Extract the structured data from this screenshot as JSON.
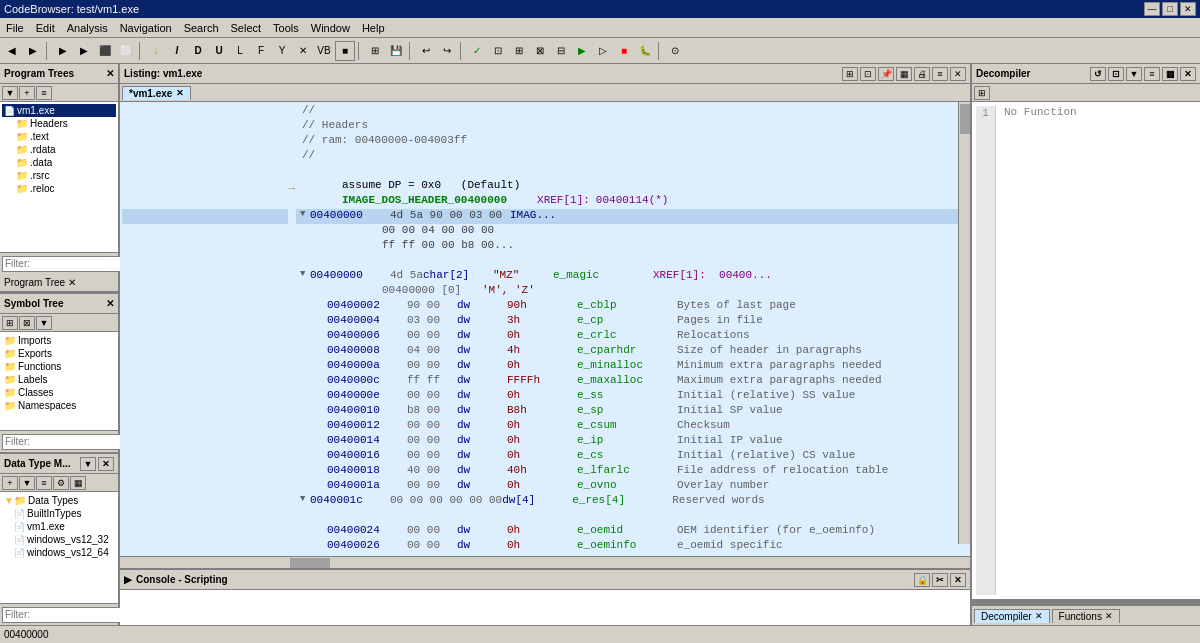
{
  "title_bar": {
    "title": "CodeBrowser: test/vm1.exe",
    "controls": [
      "—",
      "□",
      "✕"
    ]
  },
  "menu": {
    "items": [
      "File",
      "Edit",
      "Analysis",
      "Navigation",
      "Search",
      "Select",
      "Tools",
      "Window",
      "Help"
    ]
  },
  "panels": {
    "program_trees": {
      "label": "Program Trees",
      "tree_items": [
        {
          "label": "vm1.exe",
          "indent": 0,
          "type": "file",
          "expanded": true
        },
        {
          "label": "Headers",
          "indent": 1,
          "type": "folder"
        },
        {
          "label": ".text",
          "indent": 1,
          "type": "folder"
        },
        {
          "label": ".rdata",
          "indent": 1,
          "type": "folder"
        },
        {
          "label": ".data",
          "indent": 1,
          "type": "folder"
        },
        {
          "label": ".rsrc",
          "indent": 1,
          "type": "folder"
        },
        {
          "label": ".reloc",
          "indent": 1,
          "type": "folder"
        }
      ],
      "filter_placeholder": "Filter:"
    },
    "symbol_tree": {
      "label": "Symbol Tree",
      "tree_items": [
        {
          "label": "Imports",
          "indent": 0,
          "type": "folder"
        },
        {
          "label": "Exports",
          "indent": 0,
          "type": "folder"
        },
        {
          "label": "Functions",
          "indent": 0,
          "type": "folder"
        },
        {
          "label": "Labels",
          "indent": 0,
          "type": "folder"
        },
        {
          "label": "Classes",
          "indent": 0,
          "type": "folder"
        },
        {
          "label": "Namespaces",
          "indent": 0,
          "type": "folder"
        }
      ],
      "filter_placeholder": "Filter:"
    },
    "data_type_manager": {
      "label": "Data Type M...",
      "tree_items": [
        {
          "label": "Data Types",
          "indent": 0,
          "type": "folder",
          "expanded": true
        },
        {
          "label": "BuiltInTypes",
          "indent": 1,
          "type": "folder"
        },
        {
          "label": "vm1.exe",
          "indent": 1,
          "type": "file"
        },
        {
          "label": "windows_vs12_32",
          "indent": 1,
          "type": "file"
        },
        {
          "label": "windows_vs12_64",
          "indent": 1,
          "type": "file"
        }
      ],
      "filter_placeholder": "Filter:"
    }
  },
  "listing": {
    "title": "Listing: vm1.exe",
    "tab_label": "*vm1.exe",
    "lines": [
      {
        "addr": "",
        "bytes": "",
        "mnemonic": "//",
        "operand": "",
        "symbol": "",
        "comment": ""
      },
      {
        "addr": "",
        "bytes": "",
        "mnemonic": "// Headers",
        "operand": "",
        "symbol": "",
        "comment": ""
      },
      {
        "addr": "",
        "bytes": "",
        "mnemonic": "// ram: 00400000-004003ff",
        "operand": "",
        "symbol": "",
        "comment": ""
      },
      {
        "addr": "",
        "bytes": "",
        "mnemonic": "//",
        "operand": "",
        "symbol": "",
        "comment": ""
      },
      {
        "addr": "",
        "bytes": "",
        "mnemonic": "",
        "operand": "",
        "symbol": "",
        "comment": ""
      },
      {
        "addr": "",
        "bytes": "assume DP = 0x0",
        "mnemonic": "(Default)",
        "operand": "",
        "symbol": "",
        "comment": ""
      },
      {
        "addr": "",
        "bytes": "",
        "mnemonic": "IMAGE_DOS_HEADER_00400000",
        "operand": "",
        "symbol": "XREF[1]:",
        "comment": "00400114(*)"
      },
      {
        "addr": "00400000",
        "bytes": "4d 5a 90 00 03 00",
        "mnemonic": "IMAG...",
        "operand": "",
        "symbol": "",
        "comment": ""
      },
      {
        "addr": "",
        "bytes": "00 00 04 00 00 00",
        "mnemonic": "",
        "operand": "",
        "symbol": "",
        "comment": ""
      },
      {
        "addr": "",
        "bytes": "ff ff 00 00 b8 00...",
        "mnemonic": "",
        "operand": "",
        "symbol": "",
        "comment": ""
      },
      {
        "addr": "",
        "bytes": "",
        "mnemonic": "",
        "operand": "",
        "symbol": "",
        "comment": ""
      },
      {
        "addr": "00400000",
        "bytes": "4d 5a",
        "mnemonic": "char[2]",
        "operand": "\"MZ\"",
        "symbol": "e_magic",
        "comment": "XREF[1]:  00400..."
      },
      {
        "addr": "",
        "bytes": "00400000 [0]",
        "mnemonic": "",
        "operand": "'M', 'Z'",
        "symbol": "",
        "comment": ""
      },
      {
        "addr": "00400002",
        "bytes": "90 00",
        "mnemonic": "dw",
        "operand": "90h",
        "symbol": "e_cblp",
        "comment": "Bytes of last page"
      },
      {
        "addr": "00400004",
        "bytes": "03 00",
        "mnemonic": "dw",
        "operand": "3h",
        "symbol": "e_cp",
        "comment": "Pages in file"
      },
      {
        "addr": "00400006",
        "bytes": "00 00",
        "mnemonic": "dw",
        "operand": "0h",
        "symbol": "e_crlc",
        "comment": "Relocations"
      },
      {
        "addr": "00400008",
        "bytes": "04 00",
        "mnemonic": "dw",
        "operand": "4h",
        "symbol": "e_cparhdr",
        "comment": "Size of header in paragraphs"
      },
      {
        "addr": "0040000a",
        "bytes": "00 00",
        "mnemonic": "dw",
        "operand": "0h",
        "symbol": "e_minalloc",
        "comment": "Minimum extra paragraphs needed"
      },
      {
        "addr": "0040000c",
        "bytes": "ff ff",
        "mnemonic": "dw",
        "operand": "FFFFh",
        "symbol": "e_maxalloc",
        "comment": "Maximum extra paragraphs needed"
      },
      {
        "addr": "0040000e",
        "bytes": "00 00",
        "mnemonic": "dw",
        "operand": "0h",
        "symbol": "e_ss",
        "comment": "Initial (relative) SS value"
      },
      {
        "addr": "00400010",
        "bytes": "b8 00",
        "mnemonic": "dw",
        "operand": "B8h",
        "symbol": "e_sp",
        "comment": "Initial SP value"
      },
      {
        "addr": "00400012",
        "bytes": "00 00",
        "mnemonic": "dw",
        "operand": "0h",
        "symbol": "e_csum",
        "comment": "Checksum"
      },
      {
        "addr": "00400014",
        "bytes": "00 00",
        "mnemonic": "dw",
        "operand": "0h",
        "symbol": "e_ip",
        "comment": "Initial IP value"
      },
      {
        "addr": "00400016",
        "bytes": "00 00",
        "mnemonic": "dw",
        "operand": "0h",
        "symbol": "e_cs",
        "comment": "Initial (relative) CS value"
      },
      {
        "addr": "00400018",
        "bytes": "40 00",
        "mnemonic": "dw",
        "operand": "40h",
        "symbol": "e_lfarlc",
        "comment": "File address of relocation table"
      },
      {
        "addr": "0040001a",
        "bytes": "00 00",
        "mnemonic": "dw",
        "operand": "0h",
        "symbol": "e_ovno",
        "comment": "Overlay number"
      },
      {
        "addr": "0040001c",
        "bytes": "00 00 00 00 00 00",
        "mnemonic": "dw[4]",
        "operand": "",
        "symbol": "e_res[4]",
        "comment": "Reserved words"
      },
      {
        "addr": "",
        "bytes": "",
        "mnemonic": "",
        "operand": "",
        "symbol": "",
        "comment": ""
      },
      {
        "addr": "00400024",
        "bytes": "00 00",
        "mnemonic": "dw",
        "operand": "0h",
        "symbol": "e_oemid",
        "comment": "OEM identifier (for e_oeminfo)"
      },
      {
        "addr": "00400026",
        "bytes": "00 00",
        "mnemonic": "dw",
        "operand": "0h",
        "symbol": "e_oeminfo",
        "comment": "e_oemid specific"
      }
    ]
  },
  "decompiler": {
    "label": "Decompiler",
    "content": "No Function",
    "tabs": [
      {
        "label": "Decompiler",
        "active": true
      },
      {
        "label": "Functions",
        "active": false
      }
    ]
  },
  "console": {
    "label": "Console - Scripting"
  },
  "status_bar": {
    "address": "00400000"
  }
}
